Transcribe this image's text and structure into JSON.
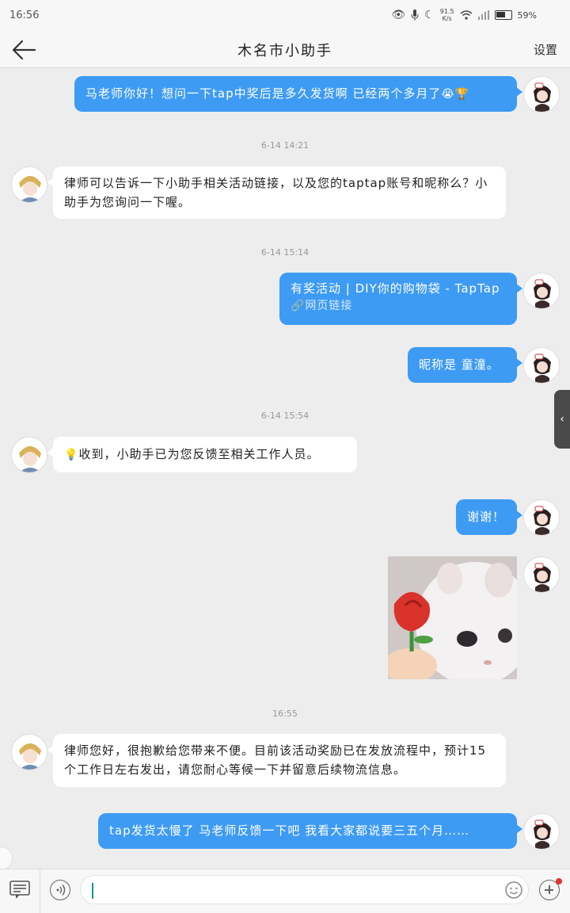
{
  "status_bar": {
    "time": "16:56",
    "net_speed_value": "91.5",
    "net_speed_unit": "K/s",
    "battery": "59%"
  },
  "header": {
    "title": "木名市小助手",
    "settings_label": "设置"
  },
  "messages": [
    {
      "type": "outgoing",
      "text": "马老师你好！想问一下tap中奖后是多久发货啊 已经两个多月了",
      "emoji": "😭🏆"
    },
    {
      "type": "timestamp",
      "text": "6-14 14:21"
    },
    {
      "type": "incoming",
      "text": "律师可以告诉一下小助手相关活动链接，以及您的taptap账号和昵称么？小助手为您询问一下喔。"
    },
    {
      "type": "timestamp",
      "text": "6-14 15:14"
    },
    {
      "type": "outgoing",
      "text": "有奖活动 | DIY你的购物袋 - TapTap",
      "subtext": "🔗网页链接"
    },
    {
      "type": "outgoing",
      "text": "昵称是 童潼。"
    },
    {
      "type": "timestamp",
      "text": "6-14 15:54"
    },
    {
      "type": "incoming",
      "emoji": "💡",
      "text": "收到，小助手已为您反馈至相关工作人员。"
    },
    {
      "type": "outgoing",
      "text": "谢谢！"
    },
    {
      "type": "outgoing_image",
      "text": ""
    },
    {
      "type": "timestamp",
      "text": "16:55"
    },
    {
      "type": "incoming",
      "text": "律师您好，很抱歉给您带来不便。目前该活动奖励已在发放流程中，预计15个工作日左右发出，请您耐心等候一下并留意后续物流信息。"
    },
    {
      "type": "outgoing",
      "text": "tap发货太慢了 马老师反馈一下吧 我看大家都说要三五个月……"
    }
  ],
  "input": {
    "value": "",
    "placeholder": ""
  },
  "colors": {
    "outgoing_bubble": "#3d9bf4",
    "incoming_bubble": "#ffffff",
    "background": "#ededed",
    "caret": "#11998a",
    "notification_dot": "#e8332c"
  },
  "icons": [
    "back-arrow-icon",
    "eye-icon",
    "microphone-icon",
    "moon-icon",
    "wifi-icon",
    "signal-icon",
    "battery-icon",
    "menu-icon",
    "voice-icon",
    "emoji-icon",
    "plus-icon",
    "chevron-left-icon"
  ]
}
